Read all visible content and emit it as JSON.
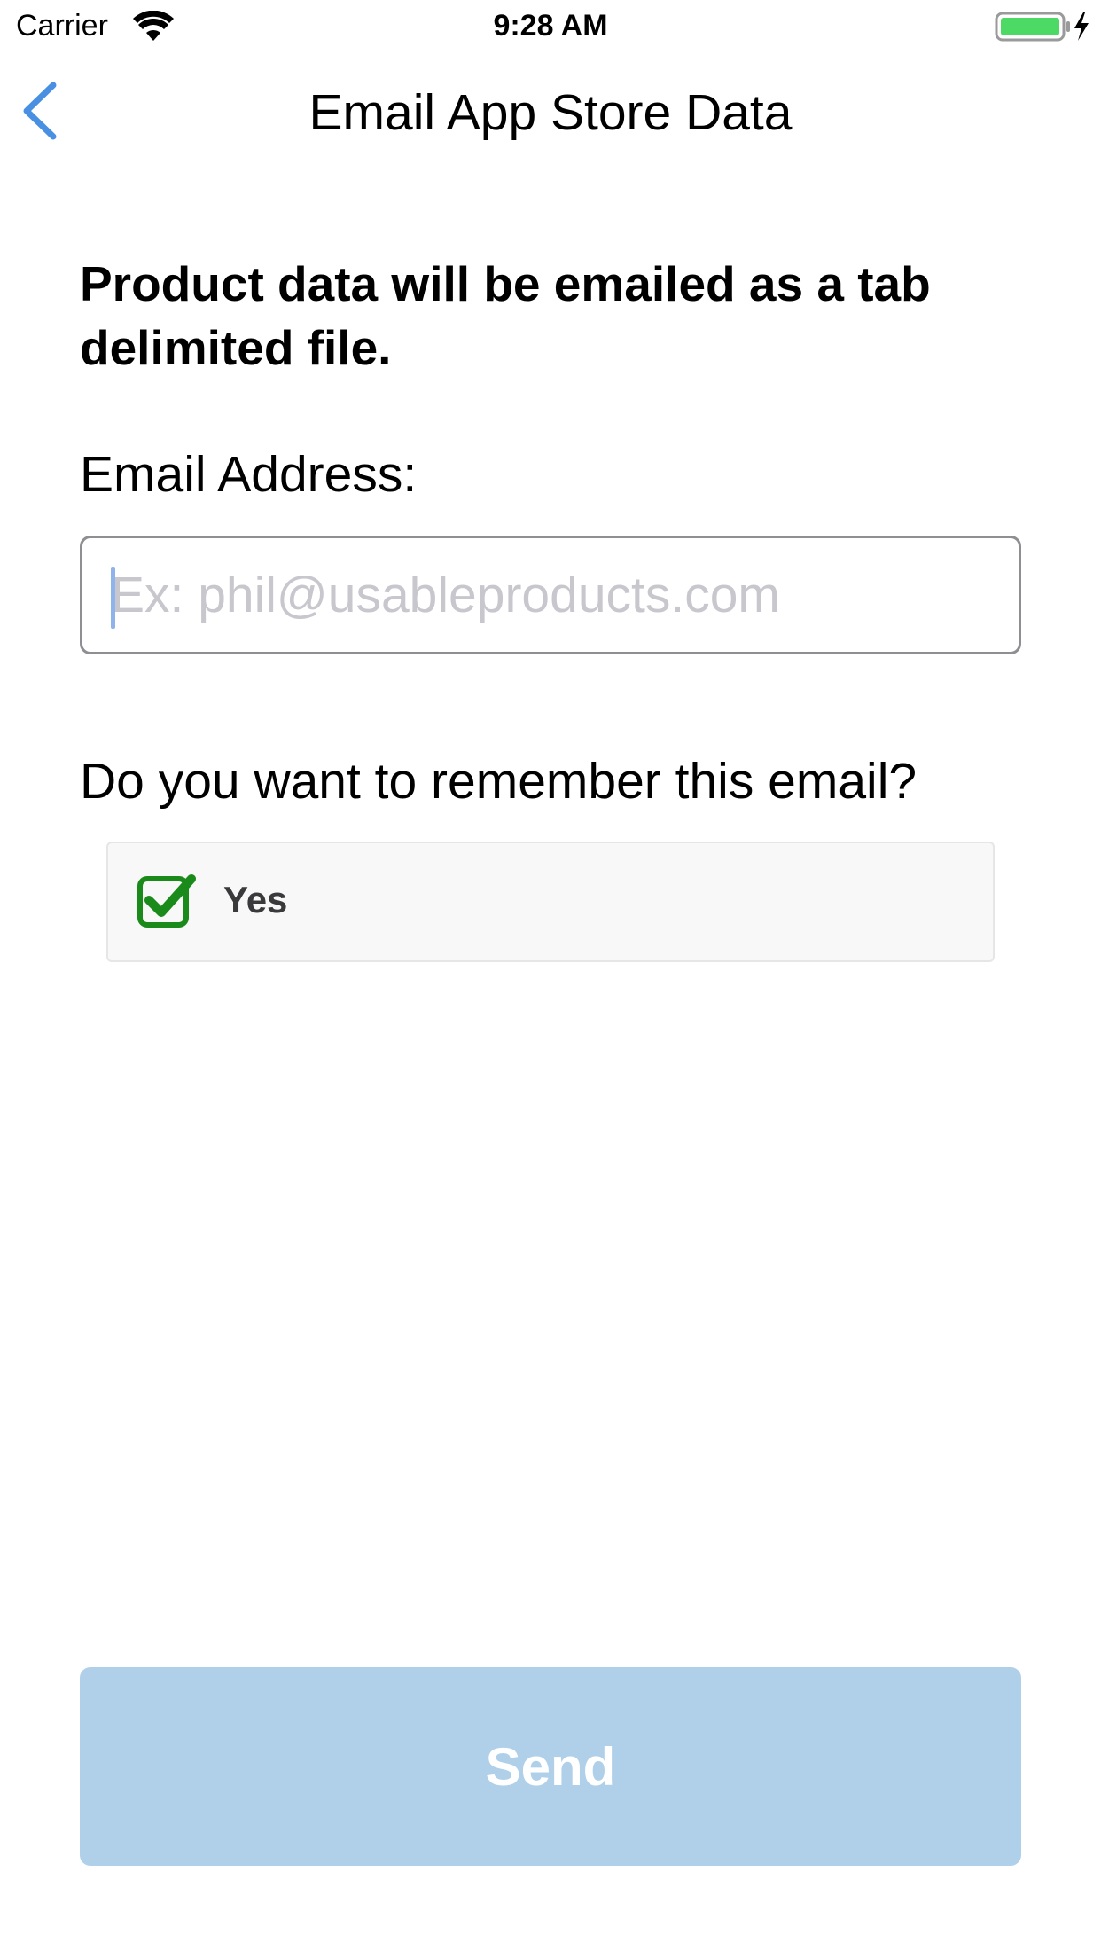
{
  "status_bar": {
    "carrier": "Carrier",
    "time": "9:28 AM",
    "wifi_icon": "wifi-icon",
    "battery_icon": "battery-charging-icon",
    "battery_color": "#4cd964"
  },
  "nav": {
    "back_icon": "chevron-left-icon",
    "title": "Email App Store Data",
    "accent_color": "#4a90e2"
  },
  "form": {
    "intro": "Product data will be emailed as a tab delimited file.",
    "email_label": "Email Address:",
    "email_value": "",
    "email_placeholder": "Ex: phil@usableproducts.com",
    "remember_question": "Do you want to remember this email?",
    "remember_option_label": "Yes",
    "remember_checked": true,
    "checkbox_color": "#1a8a1a"
  },
  "actions": {
    "send_label": "Send",
    "send_color": "#b0d0ea"
  }
}
